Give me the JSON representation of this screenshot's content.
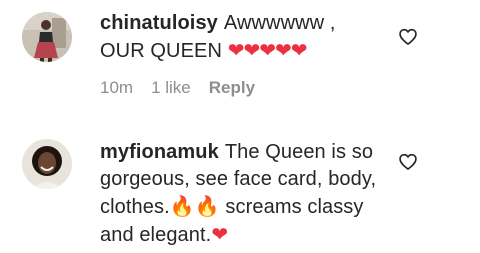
{
  "comments": [
    {
      "username": "chinatuloisy",
      "text_line1": "Awwwwww ,",
      "text_line2": "OUR QUEEN",
      "hearts": "❤❤❤❤❤",
      "time": "10m",
      "likes": "1 like",
      "reply_label": "Reply",
      "avatar_icon": "person-photo-icon",
      "like_icon": "heart-outline-icon"
    },
    {
      "username": "myfionamuk",
      "text_part1": "The Queen is so gorgeous, see face card, body, clothes.",
      "fire_emojis": "🔥🔥",
      "text_part2": "screams classy and elegant.",
      "heart": "❤",
      "avatar_icon": "person-photo-icon",
      "like_icon": "heart-outline-icon"
    }
  ],
  "colors": {
    "text": "#262626",
    "meta": "#8e8e8e",
    "heart_red": "#ed2f42"
  }
}
